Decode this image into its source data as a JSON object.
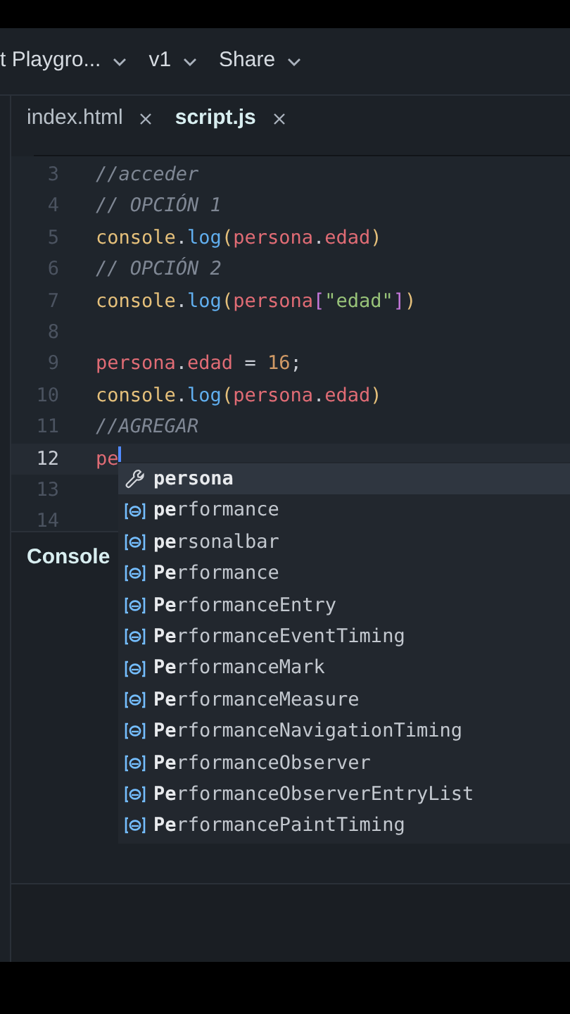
{
  "header": {
    "items": [
      {
        "label": "t Playgro..."
      },
      {
        "label": "v1"
      },
      {
        "label": "Share"
      }
    ]
  },
  "tabs": [
    {
      "label": "index.html",
      "selected": false
    },
    {
      "label": "script.js",
      "selected": true
    }
  ],
  "editor": {
    "lines": [
      {
        "number": "3",
        "current": false,
        "tokens": [
          {
            "kind": "comment",
            "text": "//acceder"
          }
        ]
      },
      {
        "number": "4",
        "current": false,
        "tokens": [
          {
            "kind": "comment",
            "text": "// OPCIÓN 1"
          }
        ]
      },
      {
        "number": "5",
        "current": false,
        "tokens": [
          {
            "kind": "object",
            "text": "console"
          },
          {
            "kind": "punct",
            "text": "."
          },
          {
            "kind": "method",
            "text": "log"
          },
          {
            "kind": "paren",
            "text": "("
          },
          {
            "kind": "variable",
            "text": "persona"
          },
          {
            "kind": "punct",
            "text": "."
          },
          {
            "kind": "variable",
            "text": "edad"
          },
          {
            "kind": "paren",
            "text": ")"
          }
        ]
      },
      {
        "number": "6",
        "current": false,
        "tokens": [
          {
            "kind": "comment",
            "text": "// OPCIÓN 2"
          }
        ]
      },
      {
        "number": "7",
        "current": false,
        "tokens": [
          {
            "kind": "object",
            "text": "console"
          },
          {
            "kind": "punct",
            "text": "."
          },
          {
            "kind": "method",
            "text": "log"
          },
          {
            "kind": "paren",
            "text": "("
          },
          {
            "kind": "variable",
            "text": "persona"
          },
          {
            "kind": "bracket",
            "text": "["
          },
          {
            "kind": "string",
            "text": "\"edad\""
          },
          {
            "kind": "bracket",
            "text": "]"
          },
          {
            "kind": "paren",
            "text": ")"
          }
        ]
      },
      {
        "number": "8",
        "current": false
      },
      {
        "number": "9",
        "current": false,
        "tokens": [
          {
            "kind": "variable",
            "text": "persona"
          },
          {
            "kind": "punct",
            "text": "."
          },
          {
            "kind": "variable",
            "text": "edad"
          },
          {
            "kind": "punct",
            "text": " = "
          },
          {
            "kind": "number",
            "text": "16"
          },
          {
            "kind": "punct",
            "text": ";"
          }
        ]
      },
      {
        "number": "10",
        "current": false,
        "tokens": [
          {
            "kind": "object",
            "text": "console"
          },
          {
            "kind": "punct",
            "text": "."
          },
          {
            "kind": "method",
            "text": "log"
          },
          {
            "kind": "paren",
            "text": "("
          },
          {
            "kind": "variable",
            "text": "persona"
          },
          {
            "kind": "punct",
            "text": "."
          },
          {
            "kind": "variable",
            "text": "edad"
          },
          {
            "kind": "paren",
            "text": ")"
          }
        ]
      },
      {
        "number": "11",
        "current": false,
        "tokens": [
          {
            "kind": "comment",
            "text": "//AGREGAR"
          }
        ]
      },
      {
        "number": "12",
        "current": true,
        "tokens": [
          {
            "kind": "variable",
            "text": "pe"
          }
        ]
      },
      {
        "number": "13",
        "current": false
      },
      {
        "number": "14",
        "current": false
      }
    ]
  },
  "console": {
    "title": "Console"
  },
  "suggestions": [
    {
      "kind": "keyword",
      "match": "persona",
      "selected": true
    },
    {
      "kind": "variable",
      "match": "pe",
      "rest": "rformance",
      "selected": false
    },
    {
      "kind": "variable",
      "match": "pe",
      "rest": "rsonalbar",
      "selected": false
    },
    {
      "kind": "variable",
      "match": "Pe",
      "rest": "rformance",
      "selected": false
    },
    {
      "kind": "variable",
      "match": "Pe",
      "rest": "rformanceEntry",
      "selected": false
    },
    {
      "kind": "variable",
      "match": "Pe",
      "rest": "rformanceEventTiming",
      "selected": false
    },
    {
      "kind": "variable",
      "match": "Pe",
      "rest": "rformanceMark",
      "selected": false
    },
    {
      "kind": "variable",
      "match": "Pe",
      "rest": "rformanceMeasure",
      "selected": false
    },
    {
      "kind": "variable",
      "match": "Pe",
      "rest": "rformanceNavigationTiming",
      "selected": false
    },
    {
      "kind": "variable",
      "match": "Pe",
      "rest": "rformanceObserver",
      "selected": false
    },
    {
      "kind": "variable",
      "match": "Pe",
      "rest": "rformanceObserverEntryList",
      "selected": false
    },
    {
      "kind": "variable",
      "match": "Pe",
      "rest": "rformancePaintTiming",
      "selected": false
    }
  ]
}
